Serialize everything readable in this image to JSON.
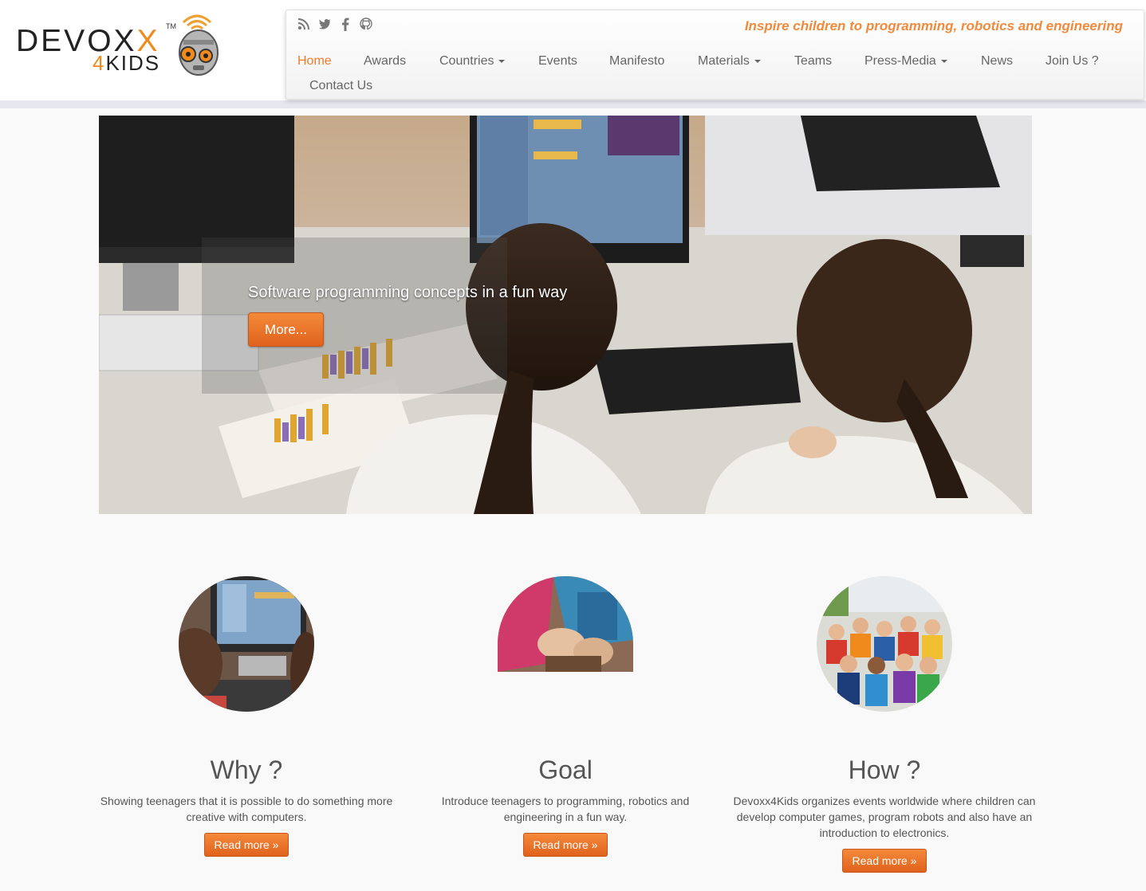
{
  "brand": {
    "logo_main": "DEVOX",
    "logo_accent": "X",
    "logo_tm": "TM",
    "logo_sub_num": "4",
    "logo_sub_text": "KIDS",
    "tagline": "Inspire children to programming, robotics and engineering",
    "accent_color": "#f07c2a"
  },
  "social_icons": [
    "rss-icon",
    "twitter-icon",
    "facebook-icon",
    "github-icon"
  ],
  "nav": [
    {
      "label": "Home",
      "active": true
    },
    {
      "label": "Awards"
    },
    {
      "label": "Countries",
      "dropdown": true
    },
    {
      "label": "Events"
    },
    {
      "label": "Manifesto"
    },
    {
      "label": "Materials",
      "dropdown": true
    },
    {
      "label": "Teams"
    },
    {
      "label": "Press-Media",
      "dropdown": true
    },
    {
      "label": "News"
    },
    {
      "label": "Join Us ?"
    },
    {
      "label": "Contact Us"
    }
  ],
  "hero": {
    "caption": "Software programming concepts in a fun way",
    "button": "More..."
  },
  "features": [
    {
      "title": "Why ?",
      "text": "Showing teenagers that it is possible to do something more creative with computers.",
      "button": "Read more »"
    },
    {
      "title": "Goal",
      "text": "Introduce teenagers to programming, robotics and engineering in a fun way.",
      "button": "Read more »"
    },
    {
      "title": "How ?",
      "text": "Devoxx4Kids organizes events worldwide where children can develop computer games, program robots and also have an introduction to electronics.",
      "button": "Read more »"
    }
  ]
}
